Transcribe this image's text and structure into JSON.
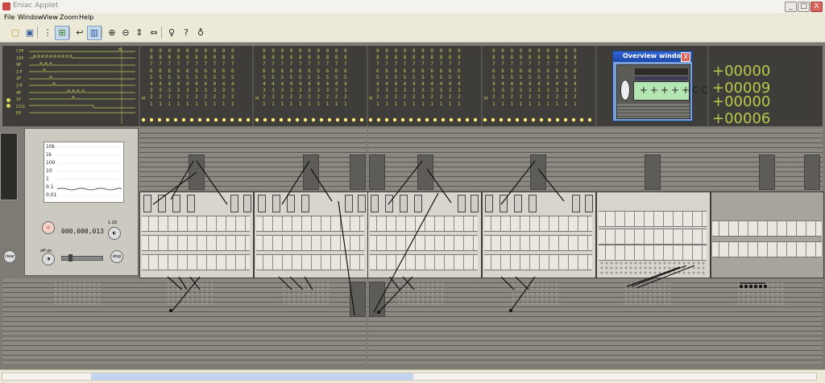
{
  "window": {
    "title": "Eniac Applet",
    "minimize": "_",
    "maximize": "□",
    "close": "X"
  },
  "menu": {
    "items": [
      "File",
      "Window",
      "View",
      "Zoom",
      "Help"
    ]
  },
  "toolbar": {
    "buttons": [
      {
        "icon": "open-folder-icon",
        "glyph": "▢"
      },
      {
        "icon": "save-icon",
        "glyph": "▣"
      },
      {
        "icon": "connect-icon",
        "glyph": "⋮"
      },
      {
        "icon": "switch-icon",
        "glyph": "⊞"
      },
      {
        "icon": "wire-icon",
        "glyph": "↩"
      },
      {
        "icon": "panel-icon",
        "glyph": "▥"
      },
      {
        "icon": "zoom-in-icon",
        "glyph": "⊕"
      },
      {
        "icon": "zoom-out-icon",
        "glyph": "⊖"
      },
      {
        "icon": "fit-height-icon",
        "glyph": "⇕"
      },
      {
        "icon": "fit-width-icon",
        "glyph": "⇔"
      },
      {
        "icon": "person-icon",
        "glyph": "♀"
      },
      {
        "icon": "question-icon",
        "glyph": "?"
      },
      {
        "icon": "bulb-icon",
        "glyph": "♁"
      }
    ]
  },
  "pulses": [
    "CPP",
    "10P",
    "9P",
    "1'P",
    "2P",
    "2'P",
    "4P",
    "1P",
    "CCG",
    "RP"
  ],
  "accumulator_digits": "9 9 9 9 9 9 9 9 9 9\n8 8 8 8 8 8 8 8 8 8\n7 7 7 7 7 7 7 7 7 7\n6 6 6 6 6 6 6 6 6 6\n5 5 5 5 5 5 5 5 5 5\n4 4 4 4 4 4 4 4 4 4\n3 3 3 3 3 3 3 3 3 3\n2 2 2 2 2 2 2 2 2 2\n1 1 1 1 1 1 1 1 1 1",
  "sign_label": "M",
  "readout": {
    "line1": "+00000 +00009",
    "line2": "+00000 +00006"
  },
  "overview": {
    "title": "Overview window",
    "close": "X"
  },
  "cycling": {
    "scale_labels": [
      "10k",
      "1k",
      "100",
      "10",
      "1",
      "0.1",
      "0.01"
    ],
    "counter": "000,000,013",
    "clear_label": "clear",
    "stop_label": "stop",
    "speed_label": "1 20",
    "switch_label": "off on"
  }
}
